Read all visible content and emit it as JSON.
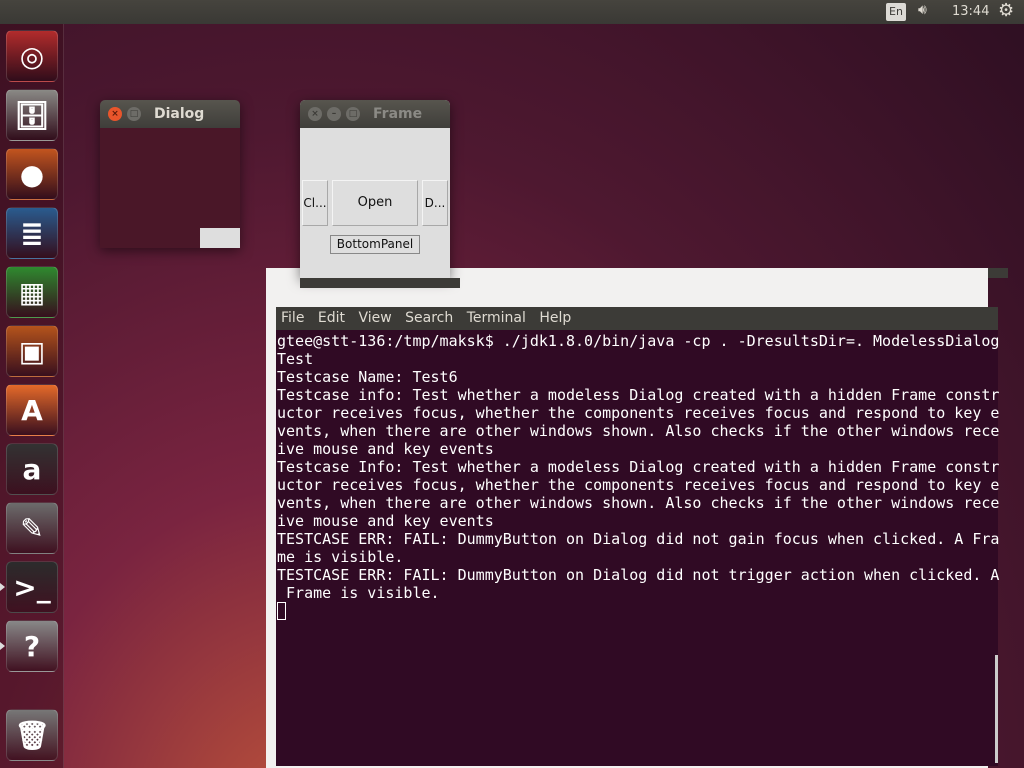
{
  "topbar": {
    "keyboard_layout": "En",
    "clock": "13:44",
    "volume_icon": "speaker-icon",
    "system_icon": "gear-icon"
  },
  "launcher": {
    "items": [
      {
        "name": "ubuntu-dash",
        "glyph": "◎"
      },
      {
        "name": "files",
        "glyph": "🗄"
      },
      {
        "name": "firefox",
        "glyph": "●"
      },
      {
        "name": "libreoffice-writer",
        "glyph": "≣"
      },
      {
        "name": "libreoffice-calc",
        "glyph": "▦"
      },
      {
        "name": "libreoffice-impress",
        "glyph": "▣"
      },
      {
        "name": "ubuntu-software-center",
        "glyph": "A"
      },
      {
        "name": "amazon",
        "glyph": "a"
      },
      {
        "name": "system-settings",
        "glyph": "✎"
      },
      {
        "name": "terminal",
        "glyph": ">_"
      },
      {
        "name": "help",
        "glyph": "?"
      },
      {
        "name": "trash",
        "glyph": "🗑"
      }
    ]
  },
  "dialog": {
    "title": "Dialog"
  },
  "frame": {
    "title": "Frame",
    "buttons": [
      "Cl...",
      "Open",
      "D..."
    ],
    "bottom_panel": "BottomPanel"
  },
  "terminal": {
    "menu": [
      "File",
      "Edit",
      "View",
      "Search",
      "Terminal",
      "Help"
    ],
    "lines": [
      "gtee@stt-136:/tmp/maksk$ ./jdk1.8.0/bin/java -cp . -DresultsDir=. ModelessDialog",
      "Test",
      "Testcase Name: Test6",
      "Testcase info: Test whether a modeless Dialog created with a hidden Frame constr",
      "uctor receives focus, whether the components receives focus and respond to key e",
      "vents, when there are other windows shown. Also checks if the other windows rece",
      "ive mouse and key events",
      "Testcase Info: Test whether a modeless Dialog created with a hidden Frame constr",
      "uctor receives focus, whether the components receives focus and respond to key e",
      "vents, when there are other windows shown. Also checks if the other windows rece",
      "ive mouse and key events",
      "TESTCASE ERR: FAIL: DummyButton on Dialog did not gain focus when clicked. A Fra",
      "me is visible.",
      "TESTCASE ERR: FAIL: DummyButton on Dialog did not trigger action when clicked. A",
      " Frame is visible."
    ]
  }
}
